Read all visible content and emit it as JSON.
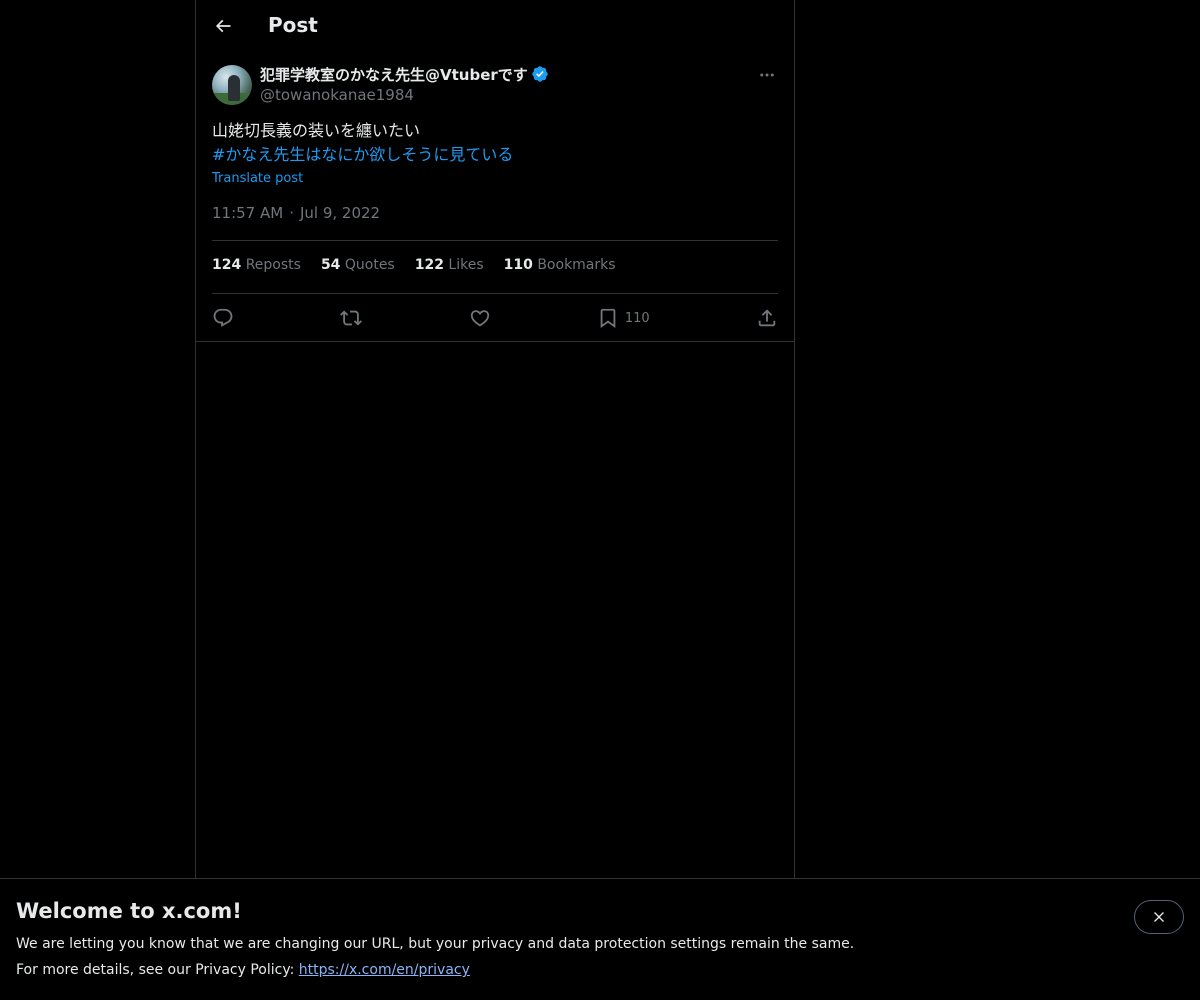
{
  "header": {
    "title": "Post"
  },
  "post": {
    "author": {
      "display_name": "犯罪学教室のかなえ先生@Vtuberです",
      "handle": "@towanokanae1984",
      "verified": true
    },
    "text": "山姥切長義の装いを纏いたい",
    "hashtag": "#かなえ先生はなにか欲しそうに見ている",
    "translate_label": "Translate post",
    "time": "11:57 AM",
    "date_separator": "·",
    "date": "Jul 9, 2022",
    "stats": {
      "reposts_count": "124",
      "reposts_label": "Reposts",
      "quotes_count": "54",
      "quotes_label": "Quotes",
      "likes_count": "122",
      "likes_label": "Likes",
      "bookmarks_count": "110",
      "bookmarks_label": "Bookmarks"
    },
    "actions": {
      "bookmark_count": "110"
    }
  },
  "banner": {
    "title": "Welcome to x.com!",
    "line1": "We are letting you know that we are changing our URL, but your privacy and data protection settings remain the same.",
    "line2_prefix": "For more details, see our Privacy Policy: ",
    "link_text": "https://x.com/en/privacy"
  },
  "colors": {
    "background": "#000000",
    "accent": "#1d9bf0",
    "muted": "#71767b",
    "border": "#2f3336",
    "text": "#e7e9ea"
  },
  "icons": [
    "back-arrow-icon",
    "verified-badge-icon",
    "more-icon",
    "reply-icon",
    "repost-icon",
    "like-icon",
    "bookmark-icon",
    "share-icon",
    "close-icon"
  ]
}
